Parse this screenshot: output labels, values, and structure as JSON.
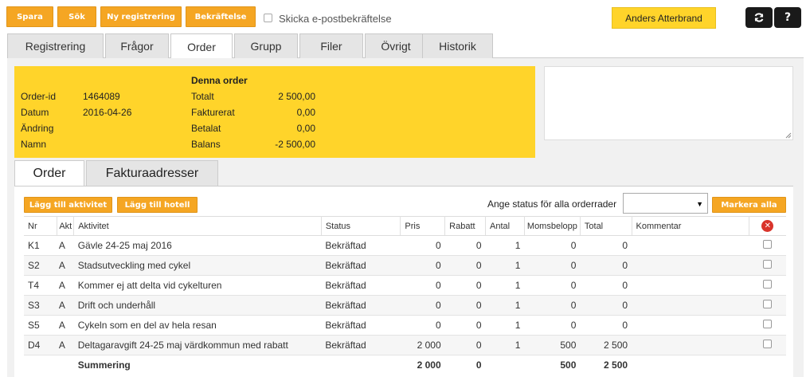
{
  "toolbar": {
    "save": "Spara",
    "search": "Sök",
    "new_registration": "Ny registrering",
    "confirmation": "Bekräftelse",
    "send_email_label": "Skicka e-postbekräftelse"
  },
  "user": {
    "name": "Anders Atterbrand"
  },
  "icons": {
    "refresh": "refresh-icon",
    "help": "?"
  },
  "tabs": [
    "Registrering",
    "Frågor",
    "Order",
    "Grupp",
    "Filer",
    "Övrigt",
    "Historik"
  ],
  "active_tab": "Order",
  "order_info": {
    "heading": "Denna order",
    "left": [
      {
        "label": "Order-id",
        "value": "1464089"
      },
      {
        "label": "Datum",
        "value": "2016-04-26"
      },
      {
        "label": "Ändring",
        "value": ""
      },
      {
        "label": "Namn",
        "value": ""
      }
    ],
    "right": [
      {
        "label": "Totalt",
        "value": "2 500,00"
      },
      {
        "label": "Fakturerat",
        "value": "0,00"
      },
      {
        "label": "Betalat",
        "value": "0,00"
      },
      {
        "label": "Balans",
        "value": "-2 500,00"
      }
    ]
  },
  "subtabs": [
    "Order",
    "Fakturaadresser"
  ],
  "actions": {
    "add_activity": "Lägg till aktivitet",
    "add_hotel": "Lägg till hotell",
    "set_status_label": "Ange status för alla orderrader",
    "mark_all": "Markera alla"
  },
  "table": {
    "headers": [
      "Nr",
      "Akt",
      "Aktivitet",
      "Status",
      "Pris",
      "Rabatt",
      "Antal",
      "Momsbelopp",
      "Total",
      "Kommentar"
    ],
    "rows": [
      {
        "nr": "K1",
        "akt": "A",
        "aktivitet": "Gävle 24-25 maj 2016",
        "status": "Bekräftad",
        "pris": "0",
        "rabatt": "0",
        "antal": "1",
        "moms": "0",
        "total": "0",
        "kommentar": ""
      },
      {
        "nr": "S2",
        "akt": "A",
        "aktivitet": "Stadsutveckling med cykel",
        "status": "Bekräftad",
        "pris": "0",
        "rabatt": "0",
        "antal": "1",
        "moms": "0",
        "total": "0",
        "kommentar": ""
      },
      {
        "nr": "T4",
        "akt": "A",
        "aktivitet": "Kommer ej att delta vid cykelturen",
        "status": "Bekräftad",
        "pris": "0",
        "rabatt": "0",
        "antal": "1",
        "moms": "0",
        "total": "0",
        "kommentar": ""
      },
      {
        "nr": "S3",
        "akt": "A",
        "aktivitet": "Drift och underhåll",
        "status": "Bekräftad",
        "pris": "0",
        "rabatt": "0",
        "antal": "1",
        "moms": "0",
        "total": "0",
        "kommentar": ""
      },
      {
        "nr": "S5",
        "akt": "A",
        "aktivitet": "Cykeln som en del av hela resan",
        "status": "Bekräftad",
        "pris": "0",
        "rabatt": "0",
        "antal": "1",
        "moms": "0",
        "total": "0",
        "kommentar": ""
      },
      {
        "nr": "D4",
        "akt": "A",
        "aktivitet": "Deltagaravgift 24-25 maj värdkommun med rabatt",
        "status": "Bekräftad",
        "pris": "2 000",
        "rabatt": "0",
        "antal": "1",
        "moms": "500",
        "total": "2 500",
        "kommentar": ""
      }
    ],
    "summary": {
      "label": "Summering",
      "pris": "2 000",
      "rabatt": "0",
      "moms": "500",
      "total": "2 500"
    }
  }
}
